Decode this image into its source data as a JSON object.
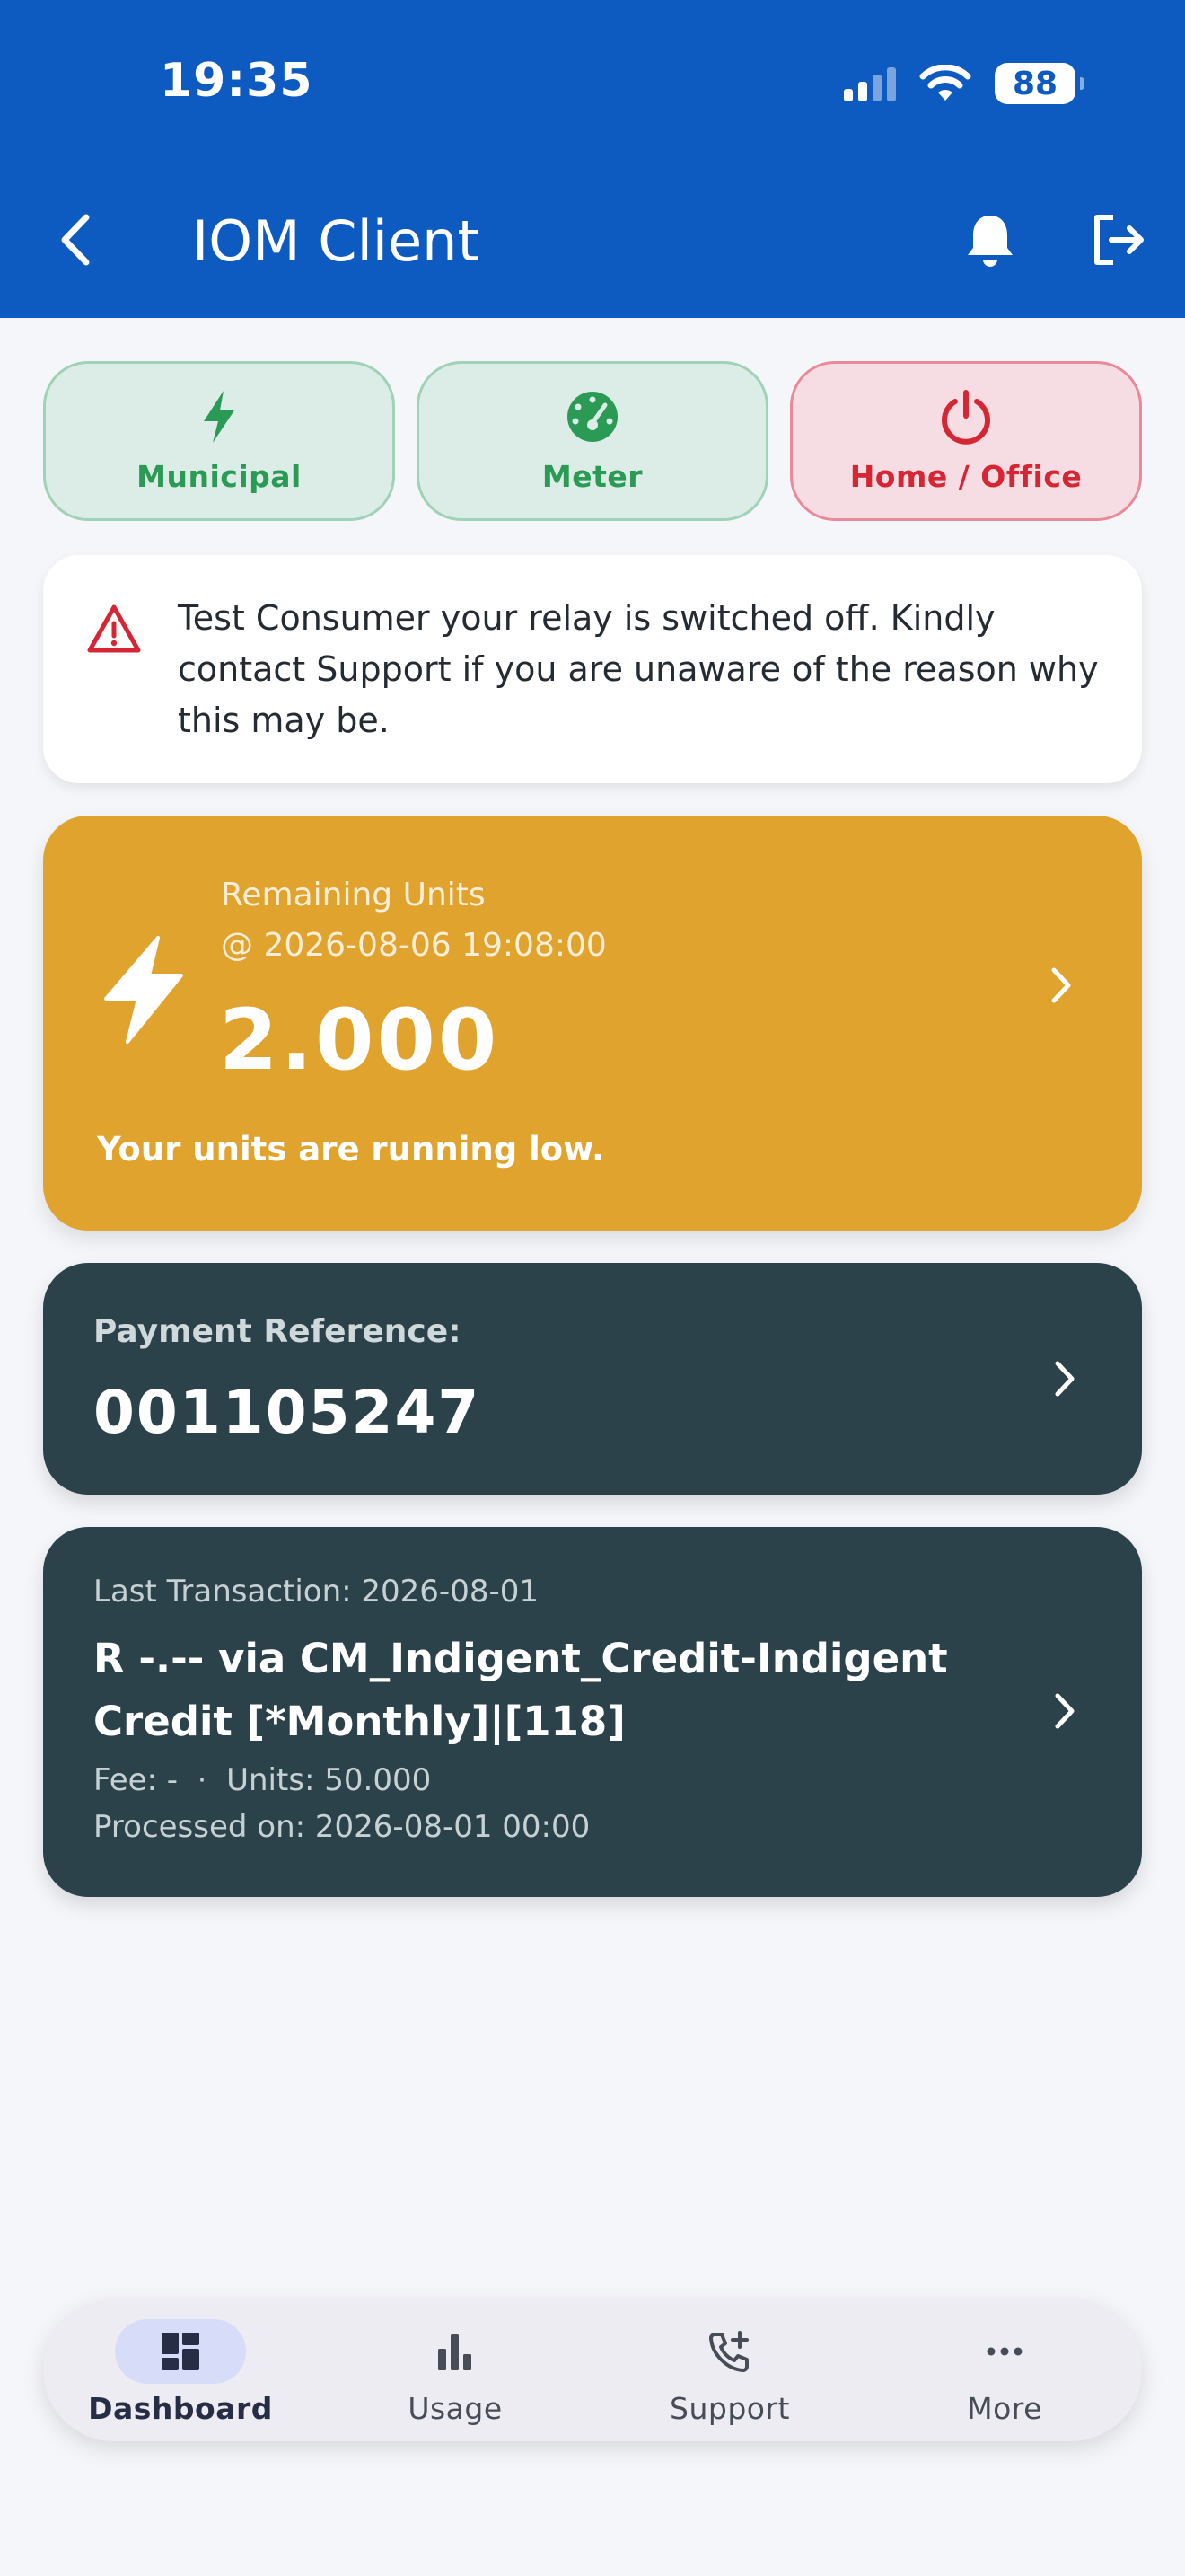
{
  "status": {
    "time": "19:35",
    "battery": "88"
  },
  "header": {
    "title": "IOM Client"
  },
  "modes": [
    {
      "label": "Municipal",
      "state": "on",
      "color": "#2a9a55"
    },
    {
      "label": "Meter",
      "state": "on",
      "color": "#2a9a55"
    },
    {
      "label": "Home / Office",
      "state": "off",
      "color": "#d62634"
    }
  ],
  "alert": {
    "text": "Test Consumer your relay is switched off. Kindly contact Support if you are unaware of the reason why this may be."
  },
  "units": {
    "label": "Remaining Units",
    "date": "@ 2026-08-06 19:08:00",
    "value": "2.000",
    "message": "Your units are running low."
  },
  "payment": {
    "label": "Payment Reference:",
    "value": "001105247"
  },
  "transaction": {
    "date_line": "Last Transaction: 2026-08-01",
    "description": "R -.-- via CM_Indigent_Credit-Indigent Credit [*Monthly]|[118]",
    "fee_line": "Fee: -  ·  Units: 50.000",
    "processed_line": "Processed on: 2026-08-01 00:00"
  },
  "nav": [
    {
      "label": "Dashboard",
      "icon": "dashboard-icon",
      "active": true
    },
    {
      "label": "Usage",
      "icon": "bar-chart-icon",
      "active": false
    },
    {
      "label": "Support",
      "icon": "phone-add-icon",
      "active": false
    },
    {
      "label": "More",
      "icon": "more-icon",
      "active": false
    }
  ],
  "colors": {
    "primary": "#0d5ac1",
    "warning": "#e0a32d",
    "card_dark": "#2c424a",
    "success": "#2a9a55",
    "danger": "#d62634"
  }
}
